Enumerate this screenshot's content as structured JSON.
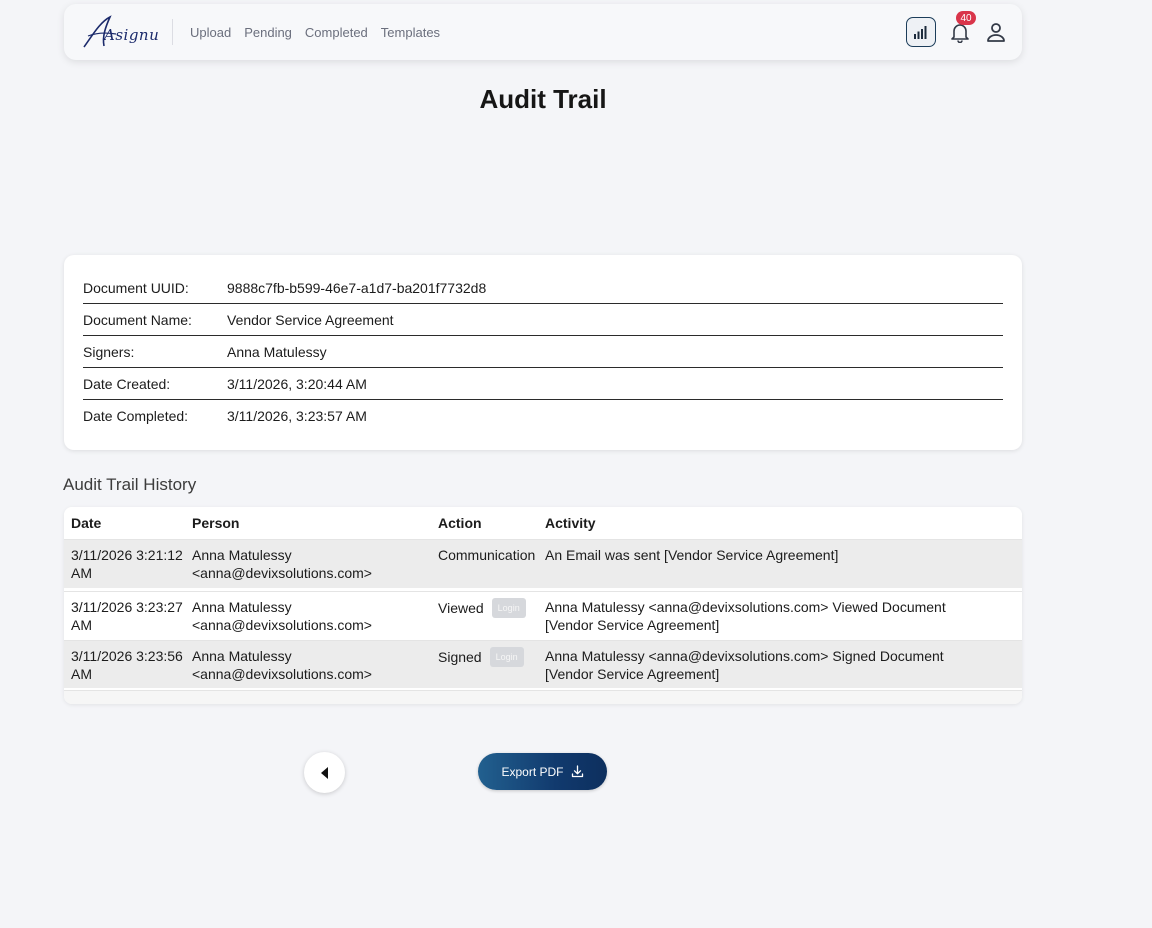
{
  "nav": {
    "logo_text": "Asignu",
    "links": [
      "Upload",
      "Pending",
      "Completed",
      "Templates"
    ],
    "notification_count": "40"
  },
  "page": {
    "title": "Audit Trail"
  },
  "document": {
    "rows": [
      {
        "label": "Document UUID:",
        "value": "9888c7fb-b599-46e7-a1d7-ba201f7732d8"
      },
      {
        "label": "Document Name:",
        "value": "Vendor Service Agreement"
      },
      {
        "label": "Signers:",
        "value": "Anna Matulessy"
      },
      {
        "label": "Date Created:",
        "value": "3/11/2026, 3:20:44 AM"
      },
      {
        "label": "Date Completed:",
        "value": "3/11/2026, 3:23:57 AM"
      }
    ]
  },
  "history": {
    "heading": "Audit Trail History",
    "columns": [
      "Date",
      "Person",
      "Action",
      "Activity"
    ],
    "rows": [
      {
        "date": "3/11/2026 3:21:12 AM",
        "person": "Anna Matulessy <anna@devixsolutions.com>",
        "action": "Communication",
        "tag": "",
        "activity": "An Email was sent [Vendor Service Agreement]"
      },
      {
        "date": "3/11/2026 3:23:27 AM",
        "person": "Anna Matulessy <anna@devixsolutions.com>",
        "action": "Viewed",
        "tag": "Login",
        "activity": "Anna Matulessy <anna@devixsolutions.com> Viewed Document [Vendor Service Agreement]"
      },
      {
        "date": "3/11/2026 3:23:56 AM",
        "person": "Anna Matulessy <anna@devixsolutions.com>",
        "action": "Signed",
        "tag": "Login",
        "activity": "Anna Matulessy <anna@devixsolutions.com> Signed Document [Vendor Service Agreement]"
      }
    ]
  },
  "actions": {
    "export_label": "Export PDF"
  },
  "icons": {
    "stats": "bar-chart-icon",
    "bell": "bell-icon",
    "user": "user-icon",
    "back": "caret-left-icon",
    "download": "download-icon"
  },
  "colors": {
    "brand": "#1b2a6b",
    "badge": "#d9354a",
    "export_start": "#22608f",
    "export_end": "#0d2f5e"
  }
}
